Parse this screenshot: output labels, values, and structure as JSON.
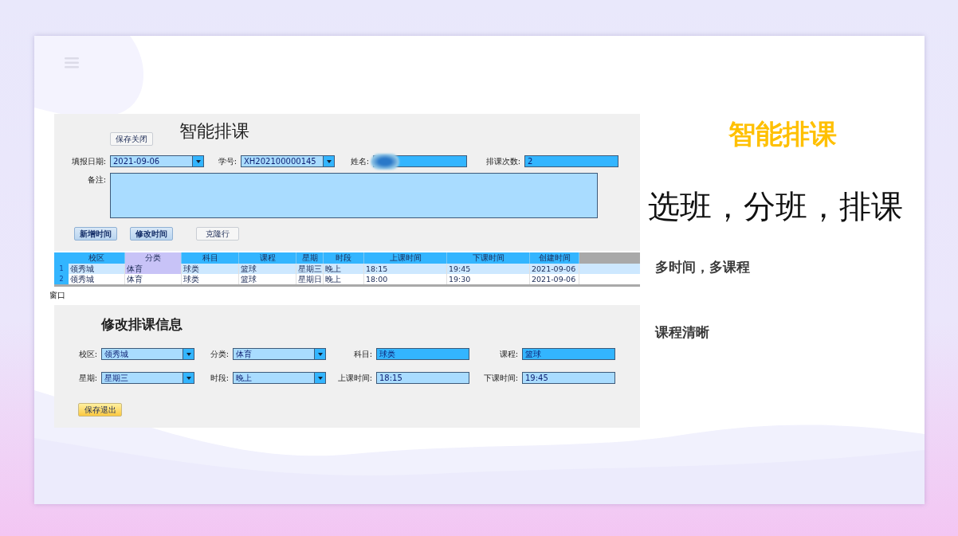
{
  "slide": {
    "title": "智能排课",
    "headline": "选班，分班，排课",
    "points": [
      "多时间，多课程",
      "课程清晰"
    ]
  },
  "form": {
    "title": "智能排课",
    "close_button": "保存关闭",
    "fields": [
      {
        "label": "填报日期:",
        "kind": "dropdown",
        "highlighted": false,
        "value": "2021-09-06"
      },
      {
        "label": "学号:",
        "kind": "dropdown",
        "highlighted": false,
        "value": "XH202100000145"
      },
      {
        "label": "姓名:",
        "kind": "redacted",
        "highlighted": true
      },
      {
        "label": "排课次数:",
        "kind": "input",
        "highlighted": true,
        "value": "2"
      }
    ],
    "remark_label": "备注:",
    "buttons": [
      {
        "label": "新增时间",
        "kind": "pressed"
      },
      {
        "label": "修改时间",
        "kind": "pressed"
      },
      {
        "label": "克隆行",
        "kind": "plain"
      }
    ]
  },
  "table": {
    "columns": [
      {
        "label": "校区",
        "selected": false
      },
      {
        "label": "分类",
        "selected": true
      },
      {
        "label": "科目",
        "selected": false
      },
      {
        "label": "课程",
        "selected": false
      },
      {
        "label": "星期",
        "selected": false
      },
      {
        "label": "时段",
        "selected": false
      },
      {
        "label": "上课时间",
        "selected": false
      },
      {
        "label": "下课时间",
        "selected": false
      },
      {
        "label": "创建时间",
        "selected": false
      }
    ],
    "rows": [
      {
        "index": "1",
        "selected": true,
        "cells": [
          "领秀城",
          "体育",
          "球类",
          "篮球",
          "星期三",
          "晚上",
          "18:15",
          "19:45",
          "2021-09-06"
        ]
      },
      {
        "index": "2",
        "selected": false,
        "cells": [
          "领秀城",
          "体育",
          "球类",
          "篮球",
          "星期日",
          "晚上",
          "18:00",
          "19:30",
          "2021-09-06"
        ]
      }
    ]
  },
  "window_label": "窗口",
  "edit": {
    "title": "修改排课信息",
    "fields": [
      {
        "label": "校区:",
        "kind": "dropdown",
        "highlighted": false,
        "value": "领秀城"
      },
      {
        "label": "分类:",
        "kind": "dropdown",
        "highlighted": false,
        "value": "体育"
      },
      {
        "label": "科目:",
        "kind": "input",
        "highlighted": true,
        "value": "球类"
      },
      {
        "label": "课程:",
        "kind": "input",
        "highlighted": true,
        "value": "篮球"
      },
      {
        "label": "星期:",
        "kind": "dropdown",
        "highlighted": false,
        "value": "星期三"
      },
      {
        "label": "时段:",
        "kind": "dropdown",
        "highlighted": false,
        "value": "晚上"
      },
      {
        "label": "上课时间:",
        "kind": "input",
        "highlighted": false,
        "value": "18:15"
      },
      {
        "label": "下课时间:",
        "kind": "input",
        "highlighted": false,
        "value": "19:45"
      }
    ],
    "save_button": "保存退出"
  }
}
